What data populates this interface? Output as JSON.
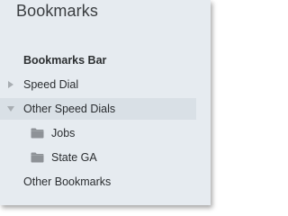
{
  "panel": {
    "title": "Bookmarks",
    "section_header": "Bookmarks Bar"
  },
  "tree": {
    "speed_dial": {
      "label": "Speed Dial",
      "expanded": false
    },
    "other_speed_dials": {
      "label": "Other Speed Dials",
      "expanded": true,
      "selected": true
    },
    "jobs": {
      "label": "Jobs",
      "icon": "folder-icon"
    },
    "state_ga": {
      "label": "State GA",
      "icon": "folder-icon"
    },
    "other_bookmarks": {
      "label": "Other Bookmarks"
    }
  },
  "colors": {
    "panel_bg": "#e6ebf0",
    "selected_row_bg": "#d9e0e6",
    "folder": "#8e9297",
    "caret": "#a8adb2"
  }
}
